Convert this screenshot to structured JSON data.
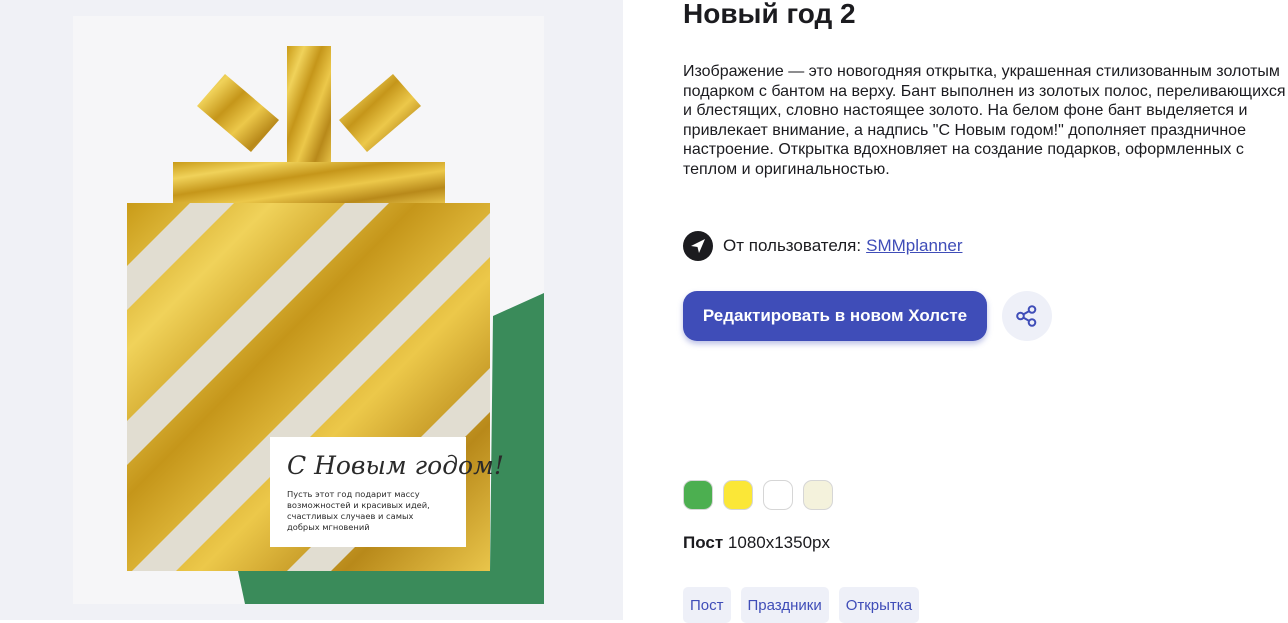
{
  "title": "Новый год 2",
  "description": "Изображение — это новогодняя открытка, украшенная стилизованным золотым подарком с бантом на верху. Бант выполнен из золотых полос, переливающихся и блестящих, словно настоящее золото. На белом фоне бант выделяется и привлекает внимание, а надпись \"С Новым годом!\" дополняет праздничное настроение. Открытка вдохновляет на создание подарков, оформленных с теплом и оригинальностью.",
  "author": {
    "prefix": "От пользователя:",
    "name": "SMMplanner",
    "icon": "paper-plane-icon"
  },
  "edit_button": "Редактировать в новом Холсте",
  "share_icon": "share-icon",
  "colors": [
    "#4caf50",
    "#fbe737",
    "#ffffff",
    "#f4f2dc"
  ],
  "size": {
    "label": "Пост",
    "value": "1080x1350px"
  },
  "tags": [
    "Пост",
    "Праздники",
    "Открытка"
  ],
  "card": {
    "greeting": "С Новым годом!",
    "text_lines": [
      "Пусть этот год подарит массу",
      "возможностей и красивых идей,",
      "счастливых случаев и самых",
      "добрых мгновений"
    ]
  }
}
